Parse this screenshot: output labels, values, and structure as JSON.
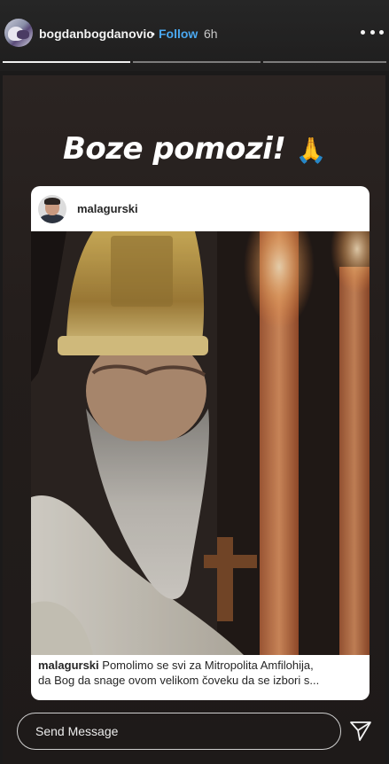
{
  "header": {
    "username": "bogdanbogdanovic",
    "separator": "•",
    "follow_label": "Follow",
    "time": "6h"
  },
  "story": {
    "caption": "Boze pomozi!",
    "caption_emoji": "🙏",
    "progress_segments": 3,
    "active_segment": 1
  },
  "post": {
    "username": "malagurski",
    "caption_user": "malagurski",
    "caption_text_line1": "Pomolimo se svi za Mitropolita Amfilohija,",
    "caption_text_line2": "da Bog da snage ovom velikom čoveku da se izbori s..."
  },
  "composer": {
    "placeholder": "Send Message",
    "send_icon": "paper-plane-icon"
  },
  "colors": {
    "follow": "#4aa8f0",
    "background": "#1b1a1a"
  }
}
